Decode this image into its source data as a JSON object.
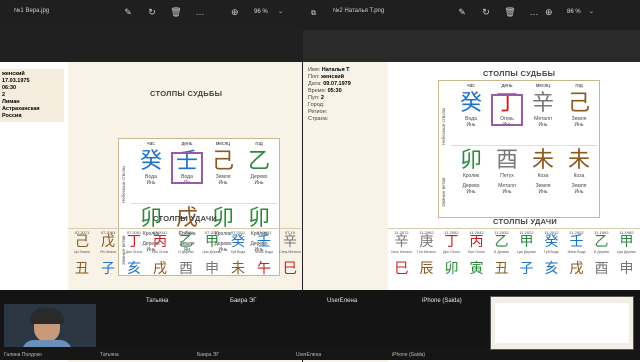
{
  "window1": {
    "title": "№1 Вера.jpg",
    "zoom": "96 %",
    "info": {
      "lines": [
        {
          "k": "",
          "v": "женский"
        },
        {
          "k": "",
          "v": "17.03.1975"
        },
        {
          "k": "",
          "v": "06:30"
        },
        {
          "k": "",
          "v": "2"
        },
        {
          "k": "",
          "v": "Лиман"
        },
        {
          "k": "",
          "v": "Астраханская"
        },
        {
          "k": "",
          "v": ""
        },
        {
          "k": "",
          "v": "Россия"
        }
      ]
    },
    "title_pillars": "СТОЛПЫ СУДЬБЫ",
    "headers": [
      "час",
      "день",
      "месяц",
      "год"
    ],
    "side_top": "Небесные стволы",
    "side_bottom": "Земные ветви",
    "top": [
      {
        "g": "癸",
        "c1": "Вода",
        "c2": "Инь",
        "color": "#1e73c8"
      },
      {
        "g": "壬",
        "c1": "Вода",
        "c2": "Ян",
        "color": "#1e73c8"
      },
      {
        "g": "己",
        "c1": "Земля",
        "c2": "Инь",
        "color": "#8a5a1e"
      },
      {
        "g": "乙",
        "c1": "Дерево",
        "c2": "Инь",
        "color": "#2a8a3a"
      }
    ],
    "bottom": [
      {
        "g": "卯",
        "c1": "Кролик",
        "c2": "Дерево",
        "c3": "Инь",
        "color": "#2a8a3a"
      },
      {
        "g": "戌",
        "c1": "Собака",
        "c2": "Земля",
        "c3": "Ян",
        "color": "#8a5a1e"
      },
      {
        "g": "卯",
        "c1": "Кролик",
        "c2": "Дерево",
        "c3": "Инь",
        "color": "#2a8a3a"
      },
      {
        "g": "卯",
        "c1": "Кролик",
        "c2": "Дерево",
        "c3": "Инь",
        "color": "#2a8a3a"
      }
    ],
    "title_luck": "СТОЛПЫ УДАЧИ",
    "luck_years": [
      "07.2071",
      "07.2061",
      "07.2051",
      "07.2041",
      "07.2031",
      "07.2021",
      "07.2011",
      "07.2001",
      "07.19"
    ],
    "luck_top": [
      {
        "g": "己",
        "c": "Ци Земля",
        "color": "#8a5a1e"
      },
      {
        "g": "戊",
        "c": "Ян Земля",
        "color": "#8a5a1e"
      },
      {
        "g": "丁",
        "c": "Дин Огонь",
        "color": "#c8201e"
      },
      {
        "g": "丙",
        "c": "Бин Огонь",
        "color": "#c8201e"
      },
      {
        "g": "乙",
        "c": "И Дерево",
        "color": "#2a8a3a"
      },
      {
        "g": "甲",
        "c": "Цзя Дерево",
        "color": "#2a8a3a"
      },
      {
        "g": "癸",
        "c": "Гуй Вода",
        "color": "#1e73c8"
      },
      {
        "g": "壬",
        "c": "Жэнь Вода",
        "color": "#1e73c8"
      },
      {
        "g": "辛",
        "c": "Синь Металл",
        "color": "#777"
      }
    ],
    "luck_bottom": [
      {
        "g": "丑",
        "color": "#8a5a1e"
      },
      {
        "g": "子",
        "color": "#1e73c8"
      },
      {
        "g": "亥",
        "color": "#1e73c8"
      },
      {
        "g": "戌",
        "color": "#8a5a1e"
      },
      {
        "g": "酉",
        "color": "#777"
      },
      {
        "g": "申",
        "color": "#777"
      },
      {
        "g": "未",
        "color": "#8a5a1e"
      },
      {
        "g": "午",
        "color": "#c8201e"
      },
      {
        "g": "巳",
        "color": "#c8201e"
      }
    ]
  },
  "window2": {
    "title": "№2 Наталья Т.png",
    "zoom": "86 %",
    "info": {
      "lines": [
        {
          "k": "Имя:",
          "v": "Наталья Т"
        },
        {
          "k": "Пол:",
          "v": "женский"
        },
        {
          "k": "Дата:",
          "v": "09.07.1979"
        },
        {
          "k": "Время:",
          "v": "05:30"
        },
        {
          "k": "Пул:",
          "v": "2"
        },
        {
          "k": "Город:",
          "v": ""
        },
        {
          "k": "Регион:",
          "v": ""
        },
        {
          "k": "Страна:",
          "v": ""
        }
      ]
    },
    "title_pillars": "СТОЛПЫ СУДЬБЫ",
    "headers": [
      "час",
      "день",
      "месяц",
      "год"
    ],
    "side_top": "Небесные стволы",
    "side_bottom": "Земные ветви",
    "top": [
      {
        "g": "癸",
        "c1": "Вода",
        "c2": "Инь",
        "color": "#1e73c8"
      },
      {
        "g": "丁",
        "c1": "Огонь",
        "c2": "Инь",
        "color": "#c8201e"
      },
      {
        "g": "辛",
        "c1": "Металл",
        "c2": "Инь",
        "color": "#777"
      },
      {
        "g": "己",
        "c1": "Земля",
        "c2": "Инь",
        "color": "#8a5a1e"
      }
    ],
    "bottom": [
      {
        "g": "卯",
        "c1": "Кролик",
        "c2": "Дерево",
        "c3": "Инь",
        "color": "#2a8a3a"
      },
      {
        "g": "酉",
        "c1": "Петух",
        "c2": "Металл",
        "c3": "Инь",
        "color": "#777"
      },
      {
        "g": "未",
        "c1": "Коза",
        "c2": "Земля",
        "c3": "Инь",
        "color": "#8a5a1e"
      },
      {
        "g": "未",
        "c1": "Коза",
        "c2": "Земля",
        "c3": "Инь",
        "color": "#8a5a1e"
      }
    ],
    "title_luck": "СТОЛПЫ УДАЧИ",
    "luck_years": [
      "11.2072",
      "11.2062",
      "11.2052",
      "11.2042",
      "11.2032",
      "11.2022",
      "11.2012",
      "11.2002",
      "11.1992",
      "11.1982"
    ],
    "luck_top": [
      {
        "g": "辛",
        "c": "Синь Металл",
        "color": "#777"
      },
      {
        "g": "庚",
        "c": "Гэн Металл",
        "color": "#777"
      },
      {
        "g": "丁",
        "c": "Дин Огонь",
        "color": "#c8201e"
      },
      {
        "g": "丙",
        "c": "Бин Огонь",
        "color": "#c8201e"
      },
      {
        "g": "乙",
        "c": "И Дерево",
        "color": "#2a8a3a"
      },
      {
        "g": "甲",
        "c": "Цзя Дерево",
        "color": "#2a8a3a"
      },
      {
        "g": "癸",
        "c": "Гуй Вода",
        "color": "#1e73c8"
      },
      {
        "g": "壬",
        "c": "Жэнь Вода",
        "color": "#1e73c8"
      },
      {
        "g": "乙",
        "c": "И Дерево",
        "color": "#2a8a3a"
      },
      {
        "g": "甲",
        "c": "Цзя Дерево",
        "color": "#2a8a3a"
      }
    ],
    "luck_bottom": [
      {
        "g": "巳",
        "color": "#c8201e"
      },
      {
        "g": "辰",
        "color": "#8a5a1e"
      },
      {
        "g": "卯",
        "color": "#2a8a3a"
      },
      {
        "g": "寅",
        "color": "#2a8a3a"
      },
      {
        "g": "丑",
        "color": "#8a5a1e"
      },
      {
        "g": "子",
        "color": "#1e73c8"
      },
      {
        "g": "亥",
        "color": "#1e73c8"
      },
      {
        "g": "戌",
        "color": "#8a5a1e"
      },
      {
        "g": "酉",
        "color": "#777"
      },
      {
        "g": "申",
        "color": "#777"
      }
    ]
  },
  "participants_big": [
    "Татьяна",
    "Баира ЭГ",
    "UserЕлена",
    "iPhone (Saida)"
  ],
  "participants_small": [
    "Галина Полдоко",
    "Татьяна",
    "Баира ЭГ",
    "UserЕлена",
    "iPhone (Saida)"
  ],
  "toolbar_icons": [
    "edit-icon",
    "rotate-icon",
    "delete-icon",
    "more-icon",
    "zoom-icon"
  ]
}
